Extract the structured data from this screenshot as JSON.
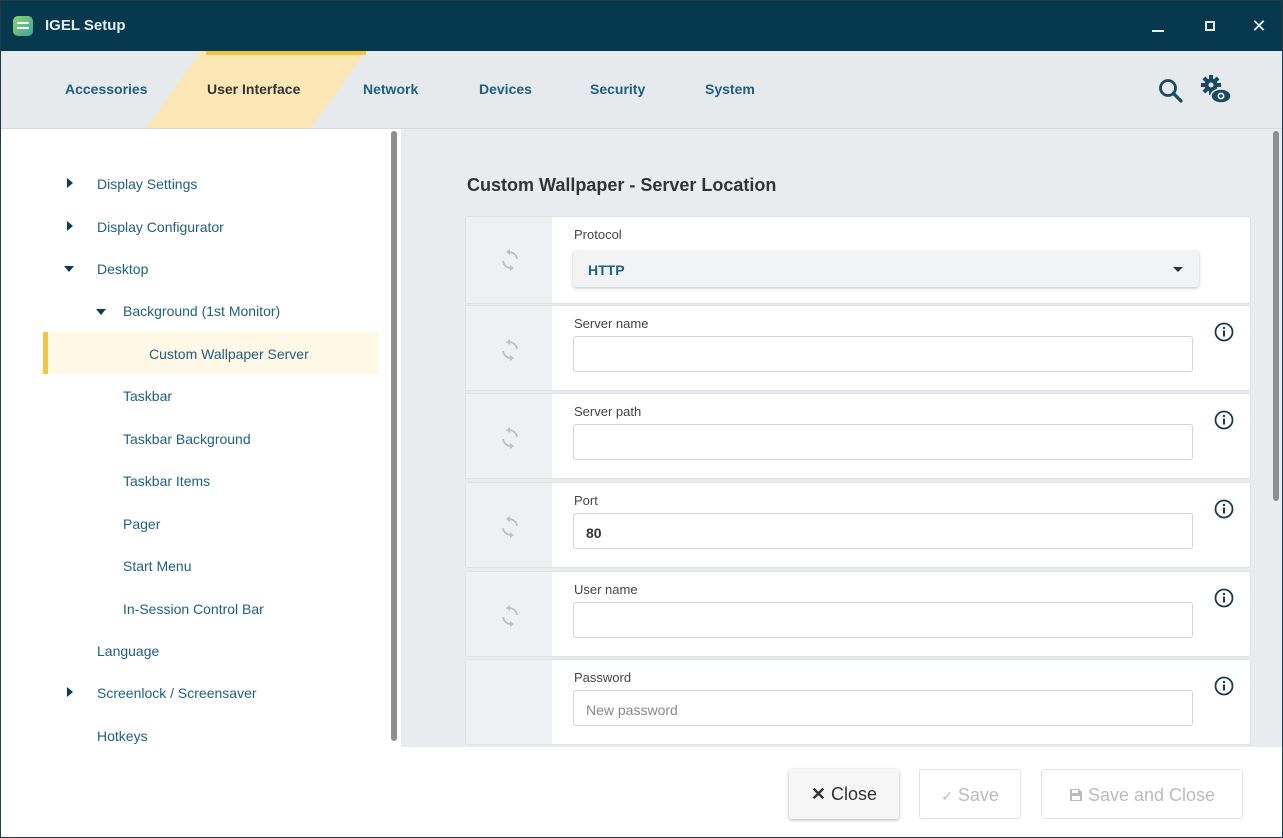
{
  "window": {
    "title": "IGEL Setup"
  },
  "nav": {
    "tabs": [
      {
        "label": "Accessories"
      },
      {
        "label": "User Interface"
      },
      {
        "label": "Network"
      },
      {
        "label": "Devices"
      },
      {
        "label": "Security"
      },
      {
        "label": "System"
      }
    ],
    "active_tab": "User Interface"
  },
  "tree": {
    "items": [
      {
        "label": "Display Settings"
      },
      {
        "label": "Display Configurator"
      },
      {
        "label": "Desktop"
      },
      {
        "label": "Background (1st Monitor)"
      },
      {
        "label": "Custom Wallpaper Server"
      },
      {
        "label": "Taskbar"
      },
      {
        "label": "Taskbar Background"
      },
      {
        "label": "Taskbar Items"
      },
      {
        "label": "Pager"
      },
      {
        "label": "Start Menu"
      },
      {
        "label": "In-Session Control Bar"
      },
      {
        "label": "Language"
      },
      {
        "label": "Screenlock / Screensaver"
      },
      {
        "label": "Hotkeys"
      }
    ],
    "selected": "Custom Wallpaper Server"
  },
  "panel": {
    "heading": "Custom Wallpaper - Server Location",
    "fields": [
      {
        "label": "Protocol",
        "value": "HTTP"
      },
      {
        "label": "Server name",
        "value": ""
      },
      {
        "label": "Server path",
        "value": ""
      },
      {
        "label": "Port",
        "value": "80"
      },
      {
        "label": "User name",
        "value": ""
      },
      {
        "label": "Password",
        "value": "",
        "placeholder": "New password"
      }
    ]
  },
  "footer": {
    "close_label": "Close",
    "save_label": "Save",
    "save_close_label": "Save and Close"
  },
  "colors": {
    "titlebar": "#06394e",
    "accent": "#f4c542",
    "link": "#1f5f80"
  }
}
